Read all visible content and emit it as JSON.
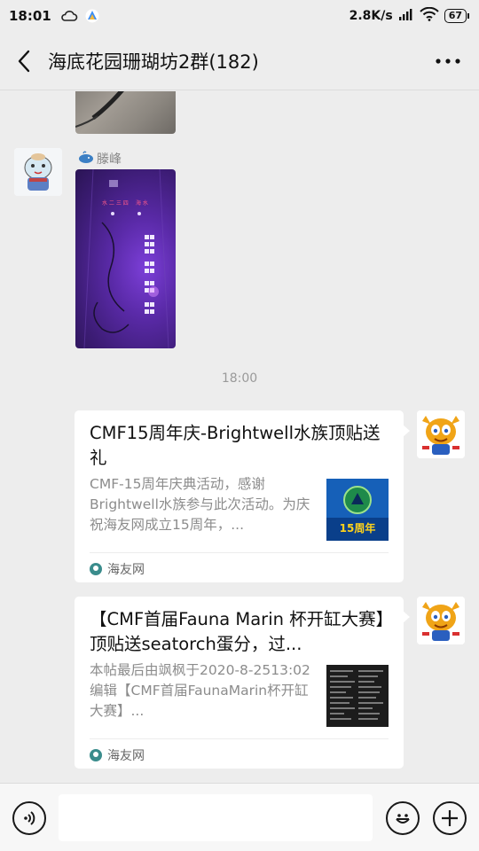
{
  "status_bar": {
    "time": "18:01",
    "network_speed": "2.8K/s",
    "battery": "67"
  },
  "header": {
    "title": "海底花园珊瑚坊2群(182)"
  },
  "messages": {
    "sender_name": "滕峰",
    "timestamp": "18:00",
    "cards": [
      {
        "title": "CMF15周年庆-Brightwell水族顶贴送礼",
        "description": "CMF-15周年庆典活动，感谢Brightwell水族参与此次活动。为庆祝海友网成立15周年，...",
        "thumb_label": "15周年",
        "source": "海友网"
      },
      {
        "title": "【CMF首届Fauna Marin 杯开缸大赛】顶贴送seatorch蛋分，过...",
        "description": "本帖最后由飒枫于2020-8-2513:02编辑【CMF首届FaunaMarin杯开缸大赛】...",
        "source": "海友网"
      }
    ]
  },
  "colors": {
    "background": "#ededed",
    "card": "#ffffff",
    "muted_text": "#8c8c8c",
    "accent_purple": "#5a2aa8"
  }
}
